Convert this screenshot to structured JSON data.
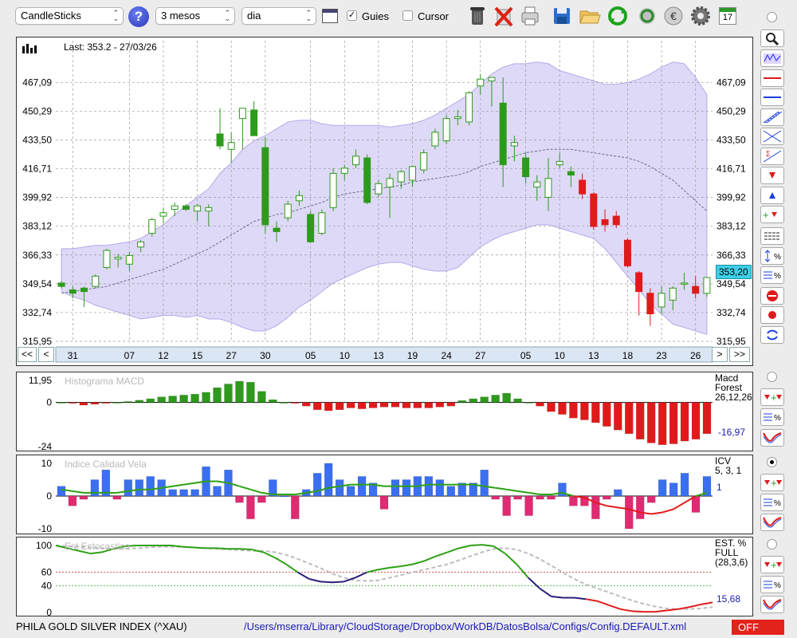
{
  "toolbar": {
    "chart_type": "CandleSticks",
    "period": "3 mesos",
    "interval": "dia",
    "guides_label": "Guies",
    "guides_checked": true,
    "cursor_label": "Cursor",
    "cursor_checked": false,
    "calendar_day": "17",
    "icons": [
      "help-icon",
      "chart-window-icon",
      "trash-icon",
      "delete-icon",
      "print-icon",
      "save-icon",
      "open-folder-icon",
      "refresh-icon",
      "refresh-all-icon",
      "currency-icon",
      "settings-icon",
      "calendar-icon"
    ]
  },
  "main_chart": {
    "last_label": "Last: 353.2 - 27/03/26",
    "current_price_badge": "353,20",
    "nav": {
      "first": "<<",
      "prev": "<",
      "next": ">",
      "last": ">>"
    }
  },
  "macd": {
    "title": "Histograma MACD",
    "legend_lines": [
      "Macd",
      "Forest",
      "26,12,26"
    ],
    "value": "-16,97"
  },
  "icv": {
    "title": "Indice Calidad Vela",
    "legend_lines": [
      "ICV",
      "5, 3, 1"
    ],
    "value": "1"
  },
  "stoch": {
    "title": "Est Estocastico",
    "legend_lines": [
      "EST. %",
      "FULL",
      "(28,3,6)"
    ],
    "value": "15,68"
  },
  "status": {
    "index_name": "PHILA GOLD  SILVER INDEX (^XAU)",
    "config_path": "/Users/mserra/Library/CloudStorage/Dropbox/WorkDB/DatosBolsa/Configs/Config.DEFAULT.xml",
    "off_label": "OFF"
  },
  "colors": {
    "up": "#2e9a1c",
    "down": "#e01a1a",
    "band": "#d4ccf5",
    "macd_up": "#2e9a1c",
    "macd_down": "#e01a1a",
    "icv_up": "#3a6ff0",
    "icv_down": "#e02a72",
    "line_green": "#2ea014",
    "line_red": "#e01a1a",
    "line_navy": "#2a1f7a",
    "line_grey": "#bdbdbd",
    "accent_badge": "#3ecfe8"
  },
  "chart_data": [
    {
      "type": "candlestick",
      "title": "",
      "ylim": [
        315.95,
        484.0
      ],
      "y_ticks": [
        "467,09",
        "450,29",
        "433,50",
        "416,71",
        "399,92",
        "383,12",
        "366,33",
        "349,54",
        "332,74",
        "315,95"
      ],
      "y_tick_values": [
        467.09,
        450.29,
        433.5,
        416.71,
        399.92,
        383.12,
        366.33,
        349.54,
        332.74,
        315.95
      ],
      "x_tick_labels": [
        "31",
        "07",
        "12",
        "15",
        "27",
        "30",
        "05",
        "10",
        "13",
        "19",
        "24",
        "27",
        "05",
        "10",
        "13",
        "18",
        "23",
        "26"
      ],
      "x_tick_index": [
        1,
        6,
        9,
        12,
        15,
        18,
        22,
        25,
        28,
        31,
        34,
        37,
        41,
        44,
        47,
        50,
        53,
        56
      ],
      "candles": [
        {
          "o": 350,
          "h": 351,
          "l": 347,
          "c": 348
        },
        {
          "o": 346,
          "h": 348,
          "l": 341,
          "c": 344
        },
        {
          "o": 347,
          "h": 348,
          "l": 336,
          "c": 345
        },
        {
          "o": 348,
          "h": 355,
          "l": 347,
          "c": 354
        },
        {
          "o": 359,
          "h": 370,
          "l": 358,
          "c": 369
        },
        {
          "o": 364,
          "h": 367,
          "l": 359,
          "c": 365
        },
        {
          "o": 361,
          "h": 368,
          "l": 357,
          "c": 366
        },
        {
          "o": 371,
          "h": 375,
          "l": 368,
          "c": 374
        },
        {
          "o": 379,
          "h": 388,
          "l": 377,
          "c": 387
        },
        {
          "o": 389,
          "h": 394,
          "l": 385,
          "c": 391
        },
        {
          "o": 393,
          "h": 397,
          "l": 389,
          "c": 395
        },
        {
          "o": 395,
          "h": 396,
          "l": 392,
          "c": 393
        },
        {
          "o": 392,
          "h": 396,
          "l": 386,
          "c": 395
        },
        {
          "o": 392,
          "h": 396,
          "l": 383,
          "c": 394
        },
        {
          "o": 437,
          "h": 452,
          "l": 428,
          "c": 430
        },
        {
          "o": 428,
          "h": 438,
          "l": 420,
          "c": 432
        },
        {
          "o": 446,
          "h": 450,
          "l": 428,
          "c": 452
        },
        {
          "o": 451,
          "h": 456,
          "l": 440,
          "c": 436
        },
        {
          "o": 429,
          "h": 435,
          "l": 379,
          "c": 384
        },
        {
          "o": 382,
          "h": 386,
          "l": 374,
          "c": 380
        },
        {
          "o": 388,
          "h": 398,
          "l": 386,
          "c": 396
        },
        {
          "o": 398,
          "h": 404,
          "l": 395,
          "c": 401
        },
        {
          "o": 390,
          "h": 392,
          "l": 375,
          "c": 374
        },
        {
          "o": 379,
          "h": 393,
          "l": 378,
          "c": 391
        },
        {
          "o": 394,
          "h": 417,
          "l": 392,
          "c": 414
        },
        {
          "o": 414,
          "h": 419,
          "l": 410,
          "c": 417
        },
        {
          "o": 419,
          "h": 428,
          "l": 417,
          "c": 424
        },
        {
          "o": 423,
          "h": 425,
          "l": 396,
          "c": 397
        },
        {
          "o": 402,
          "h": 410,
          "l": 400,
          "c": 408
        },
        {
          "o": 406,
          "h": 414,
          "l": 388,
          "c": 411
        },
        {
          "o": 409,
          "h": 416,
          "l": 405,
          "c": 415
        },
        {
          "o": 410,
          "h": 418,
          "l": 406,
          "c": 418
        },
        {
          "o": 416,
          "h": 428,
          "l": 414,
          "c": 426
        },
        {
          "o": 430,
          "h": 440,
          "l": 428,
          "c": 438
        },
        {
          "o": 433,
          "h": 448,
          "l": 431,
          "c": 446
        },
        {
          "o": 446,
          "h": 451,
          "l": 442,
          "c": 447
        },
        {
          "o": 444,
          "h": 462,
          "l": 442,
          "c": 461
        },
        {
          "o": 465,
          "h": 472,
          "l": 460,
          "c": 469
        },
        {
          "o": 468,
          "h": 470,
          "l": 453,
          "c": 470
        },
        {
          "o": 455,
          "h": 470,
          "l": 406,
          "c": 419
        },
        {
          "o": 430,
          "h": 436,
          "l": 421,
          "c": 432
        },
        {
          "o": 423,
          "h": 426,
          "l": 408,
          "c": 412
        },
        {
          "o": 406,
          "h": 413,
          "l": 398,
          "c": 409
        },
        {
          "o": 400,
          "h": 423,
          "l": 392,
          "c": 411
        },
        {
          "o": 419,
          "h": 426,
          "l": 417,
          "c": 421
        },
        {
          "o": 415,
          "h": 418,
          "l": 406,
          "c": 413
        },
        {
          "o": 410,
          "h": 414,
          "l": 399,
          "c": 402
        },
        {
          "o": 402,
          "h": 403,
          "l": 381,
          "c": 383
        },
        {
          "o": 387,
          "h": 393,
          "l": 380,
          "c": 384
        },
        {
          "o": 389,
          "h": 392,
          "l": 382,
          "c": 384
        },
        {
          "o": 375,
          "h": 376,
          "l": 359,
          "c": 360
        },
        {
          "o": 356,
          "h": 357,
          "l": 331,
          "c": 345
        },
        {
          "o": 344,
          "h": 347,
          "l": 325,
          "c": 332
        },
        {
          "o": 336,
          "h": 348,
          "l": 332,
          "c": 344
        },
        {
          "o": 340,
          "h": 348,
          "l": 334,
          "c": 347
        },
        {
          "o": 350,
          "h": 356,
          "l": 346,
          "c": 350
        },
        {
          "o": 348,
          "h": 354,
          "l": 341,
          "c": 344
        },
        {
          "o": 344,
          "h": 352,
          "l": 342,
          "c": 353.2
        }
      ],
      "bollinger_upper": [
        370,
        370,
        371,
        372,
        372,
        373,
        374,
        376,
        380,
        384,
        390,
        395,
        400,
        405,
        414,
        420,
        428,
        433,
        436,
        440,
        444,
        445,
        445,
        443,
        442,
        442,
        442,
        442,
        442,
        441,
        442,
        443,
        445,
        448,
        452,
        456,
        460,
        466,
        472,
        476,
        478,
        478,
        479,
        478,
        474,
        472,
        470,
        468,
        466,
        466,
        467,
        469,
        472,
        476,
        479,
        478,
        470,
        460
      ],
      "bollinger_lower": [
        345,
        342,
        340,
        337,
        335,
        333,
        331,
        329,
        330,
        331,
        331,
        330,
        331,
        329,
        329,
        327,
        324,
        322,
        322,
        325,
        330,
        336,
        340,
        345,
        350,
        353,
        356,
        359,
        361,
        362,
        362,
        360,
        358,
        357,
        357,
        359,
        365,
        371,
        375,
        378,
        380,
        382,
        384,
        384,
        382,
        380,
        378,
        376,
        370,
        362,
        354,
        346,
        338,
        332,
        326,
        324,
        322,
        320
      ],
      "moving_average": [
        344,
        345,
        346,
        347,
        348,
        350,
        352,
        354,
        356,
        358,
        361,
        364,
        367,
        370,
        374,
        378,
        382,
        386,
        388,
        390,
        391,
        393,
        395,
        397,
        400,
        402,
        403,
        404,
        405,
        406,
        407,
        409,
        410,
        411,
        412,
        413,
        415,
        418,
        420,
        422,
        424,
        426,
        427,
        428,
        428,
        428,
        427,
        426,
        425,
        424,
        423,
        421,
        418,
        414,
        410,
        404,
        398,
        392
      ]
    },
    {
      "type": "bar",
      "title": "Histograma MACD",
      "ylim": [
        -24,
        11.95
      ],
      "y_ticks": [
        "11,95",
        "0",
        "-24"
      ],
      "values": [
        0,
        -0.5,
        -1.5,
        -1,
        -0.5,
        0,
        0.5,
        1.2,
        2,
        3,
        3.5,
        4,
        4.5,
        5.5,
        8,
        10,
        11.5,
        11,
        6,
        1.5,
        0,
        -0.5,
        -2,
        -4,
        -4.5,
        -4,
        -3,
        -3.5,
        -3,
        -2.5,
        -2.5,
        -3,
        -3,
        -3,
        -2.5,
        -2,
        1,
        2,
        3,
        4,
        5,
        2,
        0,
        -2,
        -5,
        -6.5,
        -8.5,
        -9.5,
        -11,
        -13,
        -15,
        -17,
        -20,
        -22,
        -23,
        -22.5,
        -21,
        -20,
        -17
      ]
    },
    {
      "type": "bar",
      "title": "Indice Calidad Vela",
      "ylim": [
        -10,
        10
      ],
      "y_ticks": [
        "10",
        "0",
        "-10"
      ],
      "values": [
        3,
        -3,
        -1,
        5,
        8,
        -1,
        5,
        5,
        6,
        5,
        2,
        2,
        2,
        9,
        3,
        8,
        -2,
        -7,
        -2,
        5,
        0,
        -7,
        2,
        7,
        10,
        5,
        3,
        6,
        4,
        -4,
        5,
        5,
        6,
        6,
        5,
        3,
        4,
        4,
        8,
        -1,
        -6,
        -1,
        -6,
        -1,
        -1,
        4,
        -3,
        -3,
        -7,
        -1,
        2,
        -10,
        -7,
        -2,
        5,
        4,
        7,
        -5,
        6
      ],
      "signal_line": [
        2,
        1.5,
        1,
        1,
        1,
        1,
        1.5,
        2,
        2,
        2.5,
        3,
        3.5,
        4,
        4.5,
        4.5,
        4,
        3,
        2,
        1,
        0.5,
        0.5,
        0.5,
        1,
        1.5,
        2.5,
        3,
        3.5,
        3.5,
        3.5,
        3,
        3,
        3,
        3,
        3.5,
        3.5,
        3.5,
        3.5,
        3.5,
        3,
        2.5,
        2,
        1.5,
        1,
        0.5,
        0.5,
        1,
        0,
        -0.5,
        -2,
        -3,
        -3.5,
        -4,
        -5,
        -5.5,
        -5,
        -4,
        -2,
        0,
        1
      ]
    },
    {
      "type": "line",
      "title": "Est Estocastico",
      "ylim": [
        0,
        100
      ],
      "y_ticks": [
        "100",
        "60",
        "40",
        "0"
      ],
      "series": [
        {
          "name": "",
          "values": [
            100,
            96,
            92,
            88,
            90,
            95,
            99,
            100,
            100,
            100,
            100,
            98,
            97,
            96,
            96,
            95,
            95,
            94,
            90,
            82,
            72,
            60,
            50,
            46,
            45,
            46,
            52,
            60,
            64,
            67,
            69,
            72,
            77,
            84,
            90,
            96,
            100,
            101,
            99,
            88,
            72,
            52,
            36,
            24,
            22,
            22,
            20,
            17,
            11,
            5,
            2,
            1,
            1,
            3,
            5,
            8,
            12,
            15
          ]
        },
        {
          "name": "",
          "values": [
            100,
            99,
            98,
            97,
            96,
            95,
            95,
            96,
            97,
            98,
            98,
            98,
            97,
            96,
            95,
            94,
            93,
            92,
            92,
            90,
            86,
            80,
            73,
            66,
            58,
            52,
            48,
            47,
            48,
            52,
            56,
            60,
            64,
            68,
            72,
            78,
            84,
            90,
            95,
            96,
            94,
            88,
            80,
            70,
            60,
            50,
            42,
            36,
            30,
            24,
            18,
            13,
            9,
            6,
            5,
            5,
            6,
            8
          ]
        }
      ]
    }
  ]
}
